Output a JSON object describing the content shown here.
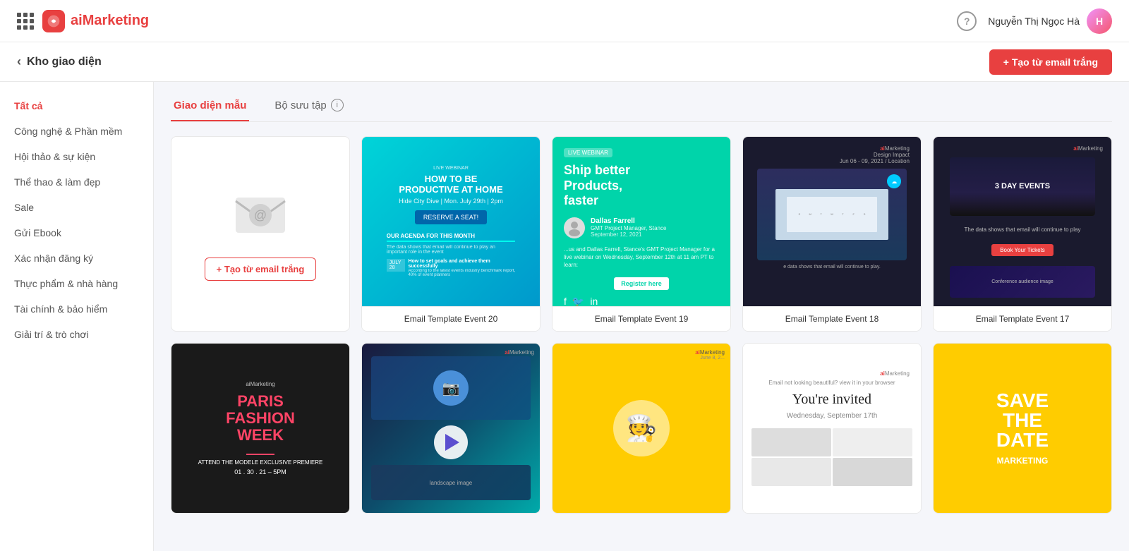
{
  "header": {
    "logo_text_prefix": "ai",
    "logo_text_suffix": "Marketing",
    "help_label": "?",
    "user_name": "Nguyễn Thị Ngọc Hà",
    "user_initials": "H"
  },
  "sub_header": {
    "back_label": "Kho giao diện",
    "create_btn_label": "+ Tạo từ email trắng"
  },
  "tabs": [
    {
      "id": "mau",
      "label": "Giao diện mẫu",
      "active": true
    },
    {
      "id": "suu_tap",
      "label": "Bộ sưu tập",
      "active": false,
      "has_info": true
    }
  ],
  "sidebar": {
    "items": [
      {
        "id": "all",
        "label": "Tất cả",
        "active": true
      },
      {
        "id": "tech",
        "label": "Công nghệ & Phần mềm",
        "active": false
      },
      {
        "id": "events",
        "label": "Hội thảo & sự kiện",
        "active": false
      },
      {
        "id": "sport",
        "label": "Thể thao & làm đẹp",
        "active": false
      },
      {
        "id": "sale",
        "label": "Sale",
        "active": false
      },
      {
        "id": "ebook",
        "label": "Gửi Ebook",
        "active": false
      },
      {
        "id": "verify",
        "label": "Xác nhận đăng ký",
        "active": false
      },
      {
        "id": "food",
        "label": "Thực phẩm & nhà hàng",
        "active": false
      },
      {
        "id": "finance",
        "label": "Tài chính & bảo hiểm",
        "active": false
      },
      {
        "id": "entertainment",
        "label": "Giải trí & trò chơi",
        "active": false
      }
    ]
  },
  "templates": {
    "row1": [
      {
        "id": "blank",
        "type": "blank"
      },
      {
        "id": "event20",
        "label": "Email Template Event 20",
        "type": "event20"
      },
      {
        "id": "event19",
        "label": "Email Template Event 19",
        "type": "event19"
      },
      {
        "id": "event18",
        "label": "Email Template Event 18",
        "type": "event18"
      },
      {
        "id": "event17",
        "label": "Email Template Event 17",
        "type": "event17"
      }
    ],
    "row2": [
      {
        "id": "fashion",
        "label": "",
        "type": "fashion"
      },
      {
        "id": "video",
        "label": "",
        "type": "video"
      },
      {
        "id": "delivery",
        "label": "",
        "type": "delivery"
      },
      {
        "id": "invitation",
        "label": "",
        "type": "invitation"
      },
      {
        "id": "savedate",
        "label": "",
        "type": "savedate"
      }
    ]
  },
  "blank_card": {
    "create_label": "+ Tạo từ email trắng"
  }
}
